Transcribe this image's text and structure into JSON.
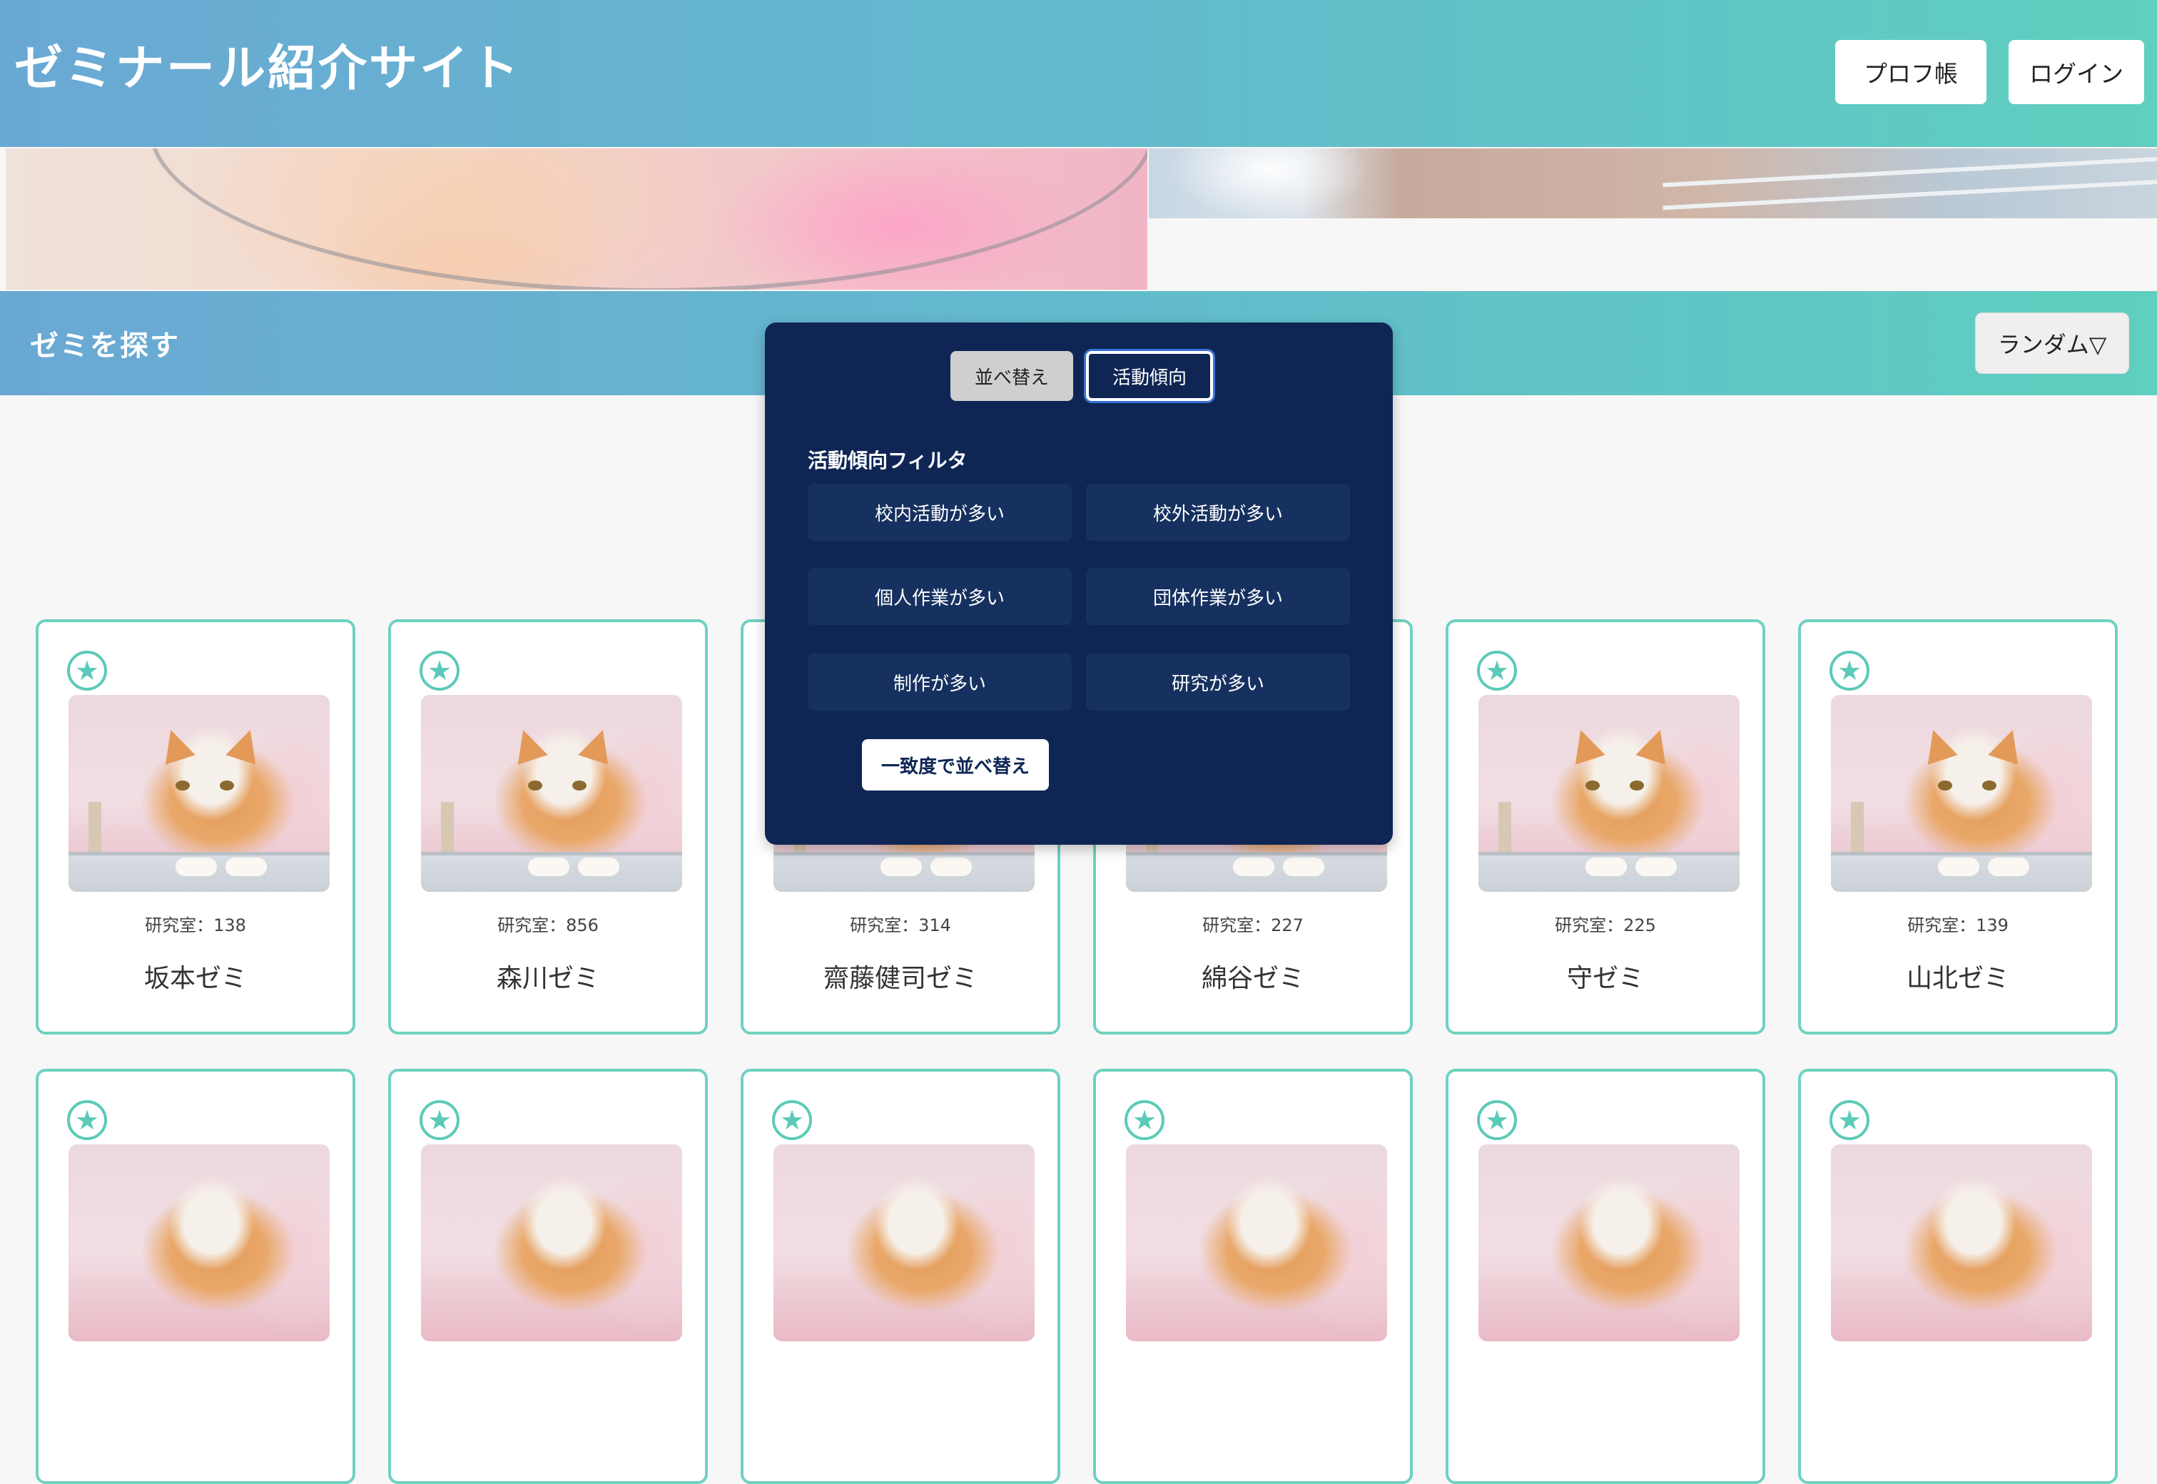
{
  "header": {
    "site_title": "ゼミナール紹介サイト",
    "prof_label": "プロフ帳",
    "login_label": "ログイン"
  },
  "search": {
    "title": "ゼミを探す",
    "sort_label": "ランダム▽"
  },
  "popup": {
    "tabs": [
      "並べ替え",
      "活動傾向"
    ],
    "active_tab": "活動傾向",
    "filter_heading": "活動傾向フィルタ",
    "filters": [
      "校内活動が多い",
      "校外活動が多い",
      "個人作業が多い",
      "団体作業が多い",
      "制作が多い",
      "研究が多い"
    ],
    "apply_label": "一致度で並べ替え"
  },
  "cards": [
    {
      "room": "研究室：138",
      "name": "坂本ゼミ"
    },
    {
      "room": "研究室：856",
      "name": "森川ゼミ"
    },
    {
      "room": "研究室：314",
      "name": "齋藤健司ゼミ"
    },
    {
      "room": "研究室：227",
      "name": "綿谷ゼミ"
    },
    {
      "room": "研究室：225",
      "name": "守ゼミ"
    },
    {
      "room": "研究室：139",
      "name": "山北ゼミ"
    }
  ],
  "icons": {
    "favorite": "star-icon"
  },
  "colors": {
    "accent_teal": "#5fcfbf",
    "header_blue": "#6aa8d4",
    "popup_navy": "#0f2655"
  }
}
